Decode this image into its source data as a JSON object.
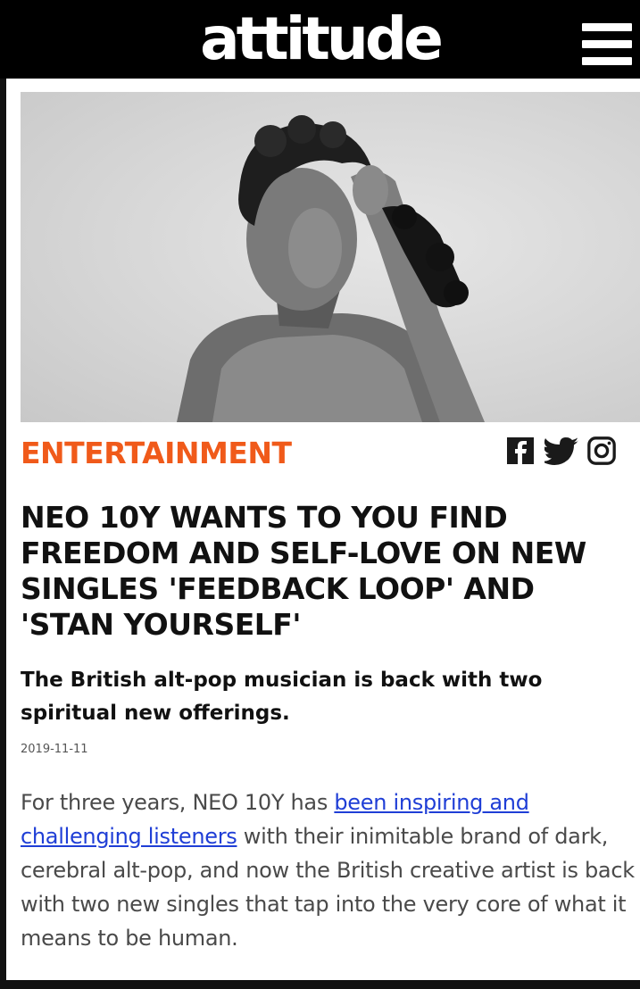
{
  "header": {
    "logo": "attitude",
    "menu_icon": "hamburger-menu-icon"
  },
  "hero": {
    "image": "black-and-white portrait photo"
  },
  "article": {
    "category": "ENTERTAINMENT",
    "share_icons": [
      "facebook-icon",
      "twitter-icon",
      "instagram-icon"
    ],
    "headline": "NEO 10Y WANTS TO YOU FIND FREEDOM AND SELF-LOVE ON NEW SINGLES 'FEEDBACK LOOP' AND 'STAN YOURSELF'",
    "subhead": "The British alt-pop musician is back with two spiritual new offerings.",
    "date": "2019-11-11",
    "body": {
      "before_link": "For three years, NEO 10Y has ",
      "link": "been inspiring and challenging listeners",
      "after_link": " with their inimitable brand of dark, cerebral alt-pop, and now the British creative artist is back with two new singles that tap into the very core of what it means to be human."
    }
  },
  "colors": {
    "accent": "#f05a1a",
    "link": "#1f3ed6",
    "header_bg": "#000000"
  }
}
